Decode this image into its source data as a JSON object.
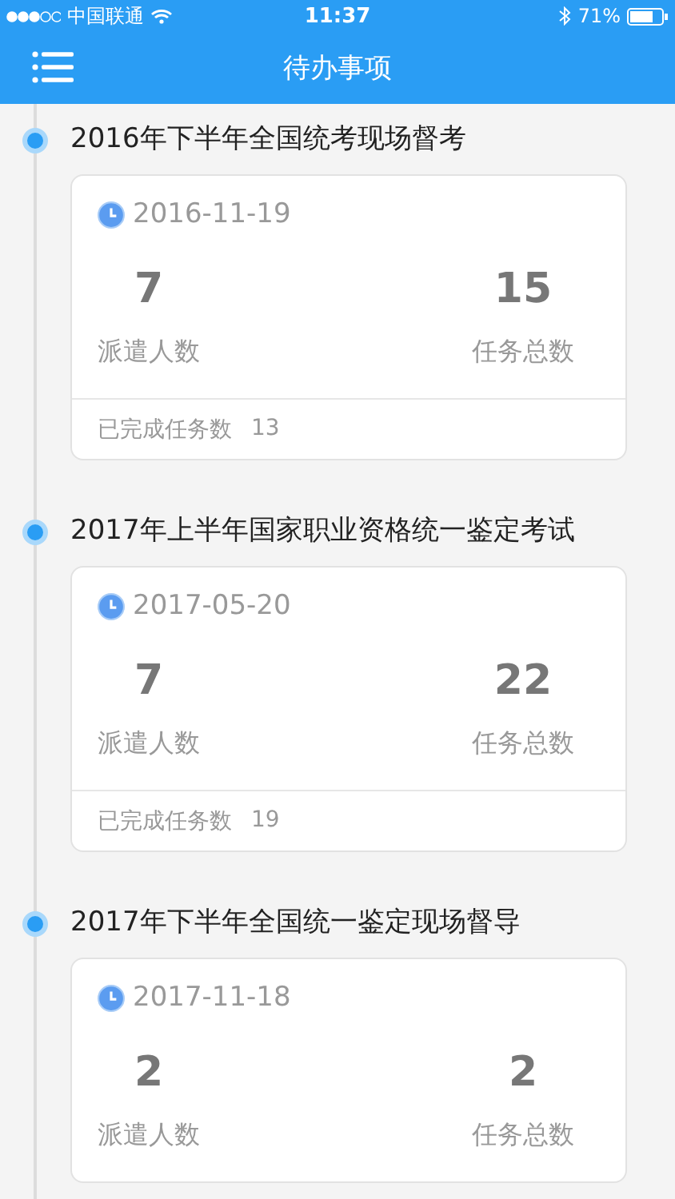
{
  "status_bar": {
    "carrier": "中国联通",
    "time": "11:37",
    "battery": "71%"
  },
  "nav": {
    "title": "待办事项"
  },
  "items": [
    {
      "title": "2016年下半年全国统考现场督考",
      "date": "2016-11-19",
      "stats": [
        {
          "value": "7",
          "label": "派遣人数"
        },
        {
          "value": "15",
          "label": "任务总数"
        }
      ],
      "footer": {
        "label": "已完成任务数",
        "value": "13"
      }
    },
    {
      "title": "2017年上半年国家职业资格统一鉴定考试",
      "date": "2017-05-20",
      "stats": [
        {
          "value": "7",
          "label": "派遣人数"
        },
        {
          "value": "22",
          "label": "任务总数"
        }
      ],
      "footer": {
        "label": "已完成任务数",
        "value": "19"
      }
    },
    {
      "title": "2017年下半年全国统一鉴定现场督导",
      "date": "2017-11-18",
      "stats": [
        {
          "value": "2",
          "label": "派遣人数"
        },
        {
          "value": "2",
          "label": "任务总数"
        }
      ]
    }
  ]
}
